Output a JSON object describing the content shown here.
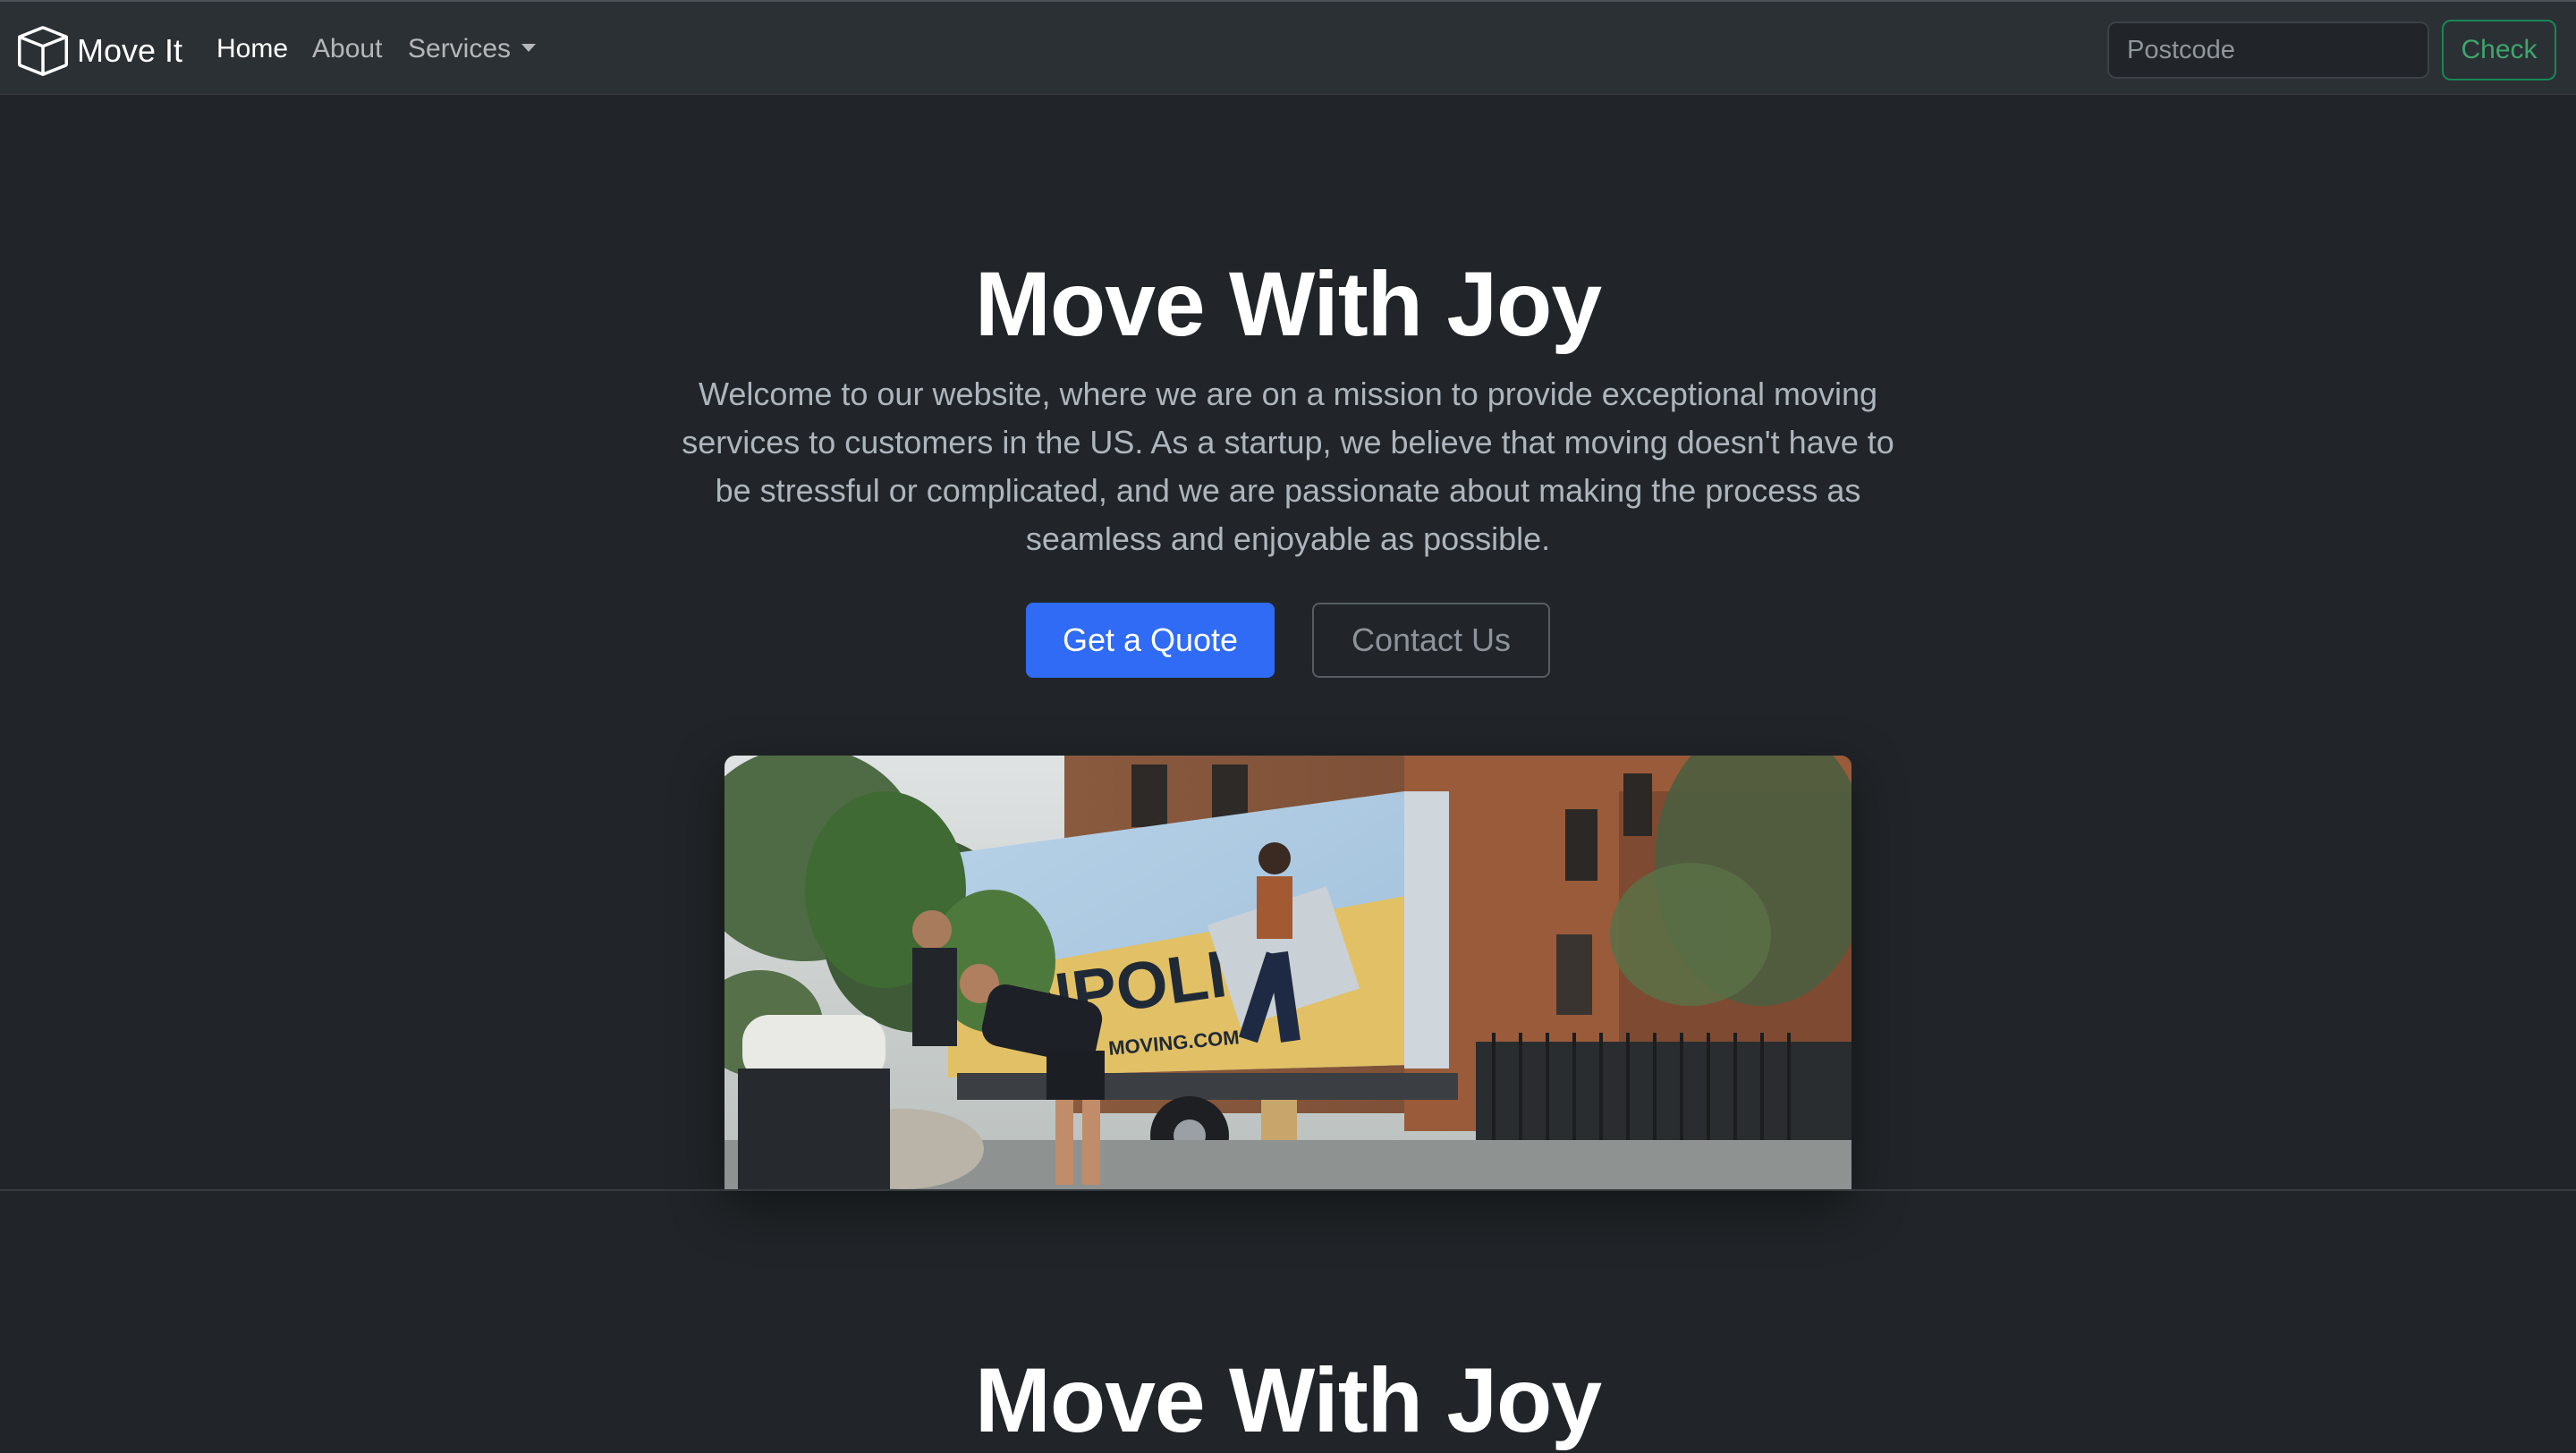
{
  "navbar": {
    "brand": "Move It",
    "brand_icon": "box-icon",
    "links": [
      {
        "label": "Home",
        "active": true
      },
      {
        "label": "About",
        "active": false
      },
      {
        "label": "Services",
        "active": false,
        "dropdown": true
      }
    ],
    "search": {
      "placeholder": "Postcode",
      "value": ""
    },
    "check_label": "Check"
  },
  "hero": {
    "title": "Move With Joy",
    "lead": "Welcome to our website, where we are on a mission to provide exceptional moving services to customers in the US. As a startup, we believe that moving doesn't have to be stressful or complicated, and we are passionate about making the process as seamless and enjoyable as possible.",
    "primary_button": "Get a Quote",
    "secondary_button": "Contact Us",
    "image_alt": "Movers unloading a plant next to a moving truck",
    "truck_text": "NPOLIS",
    "truck_url": "MOVING.COM"
  },
  "section2": {
    "title": "Move With Joy"
  },
  "colors": {
    "background": "#212529",
    "navbar": "#2b3035",
    "primary": "#2f6bf4",
    "success": "#198754"
  }
}
